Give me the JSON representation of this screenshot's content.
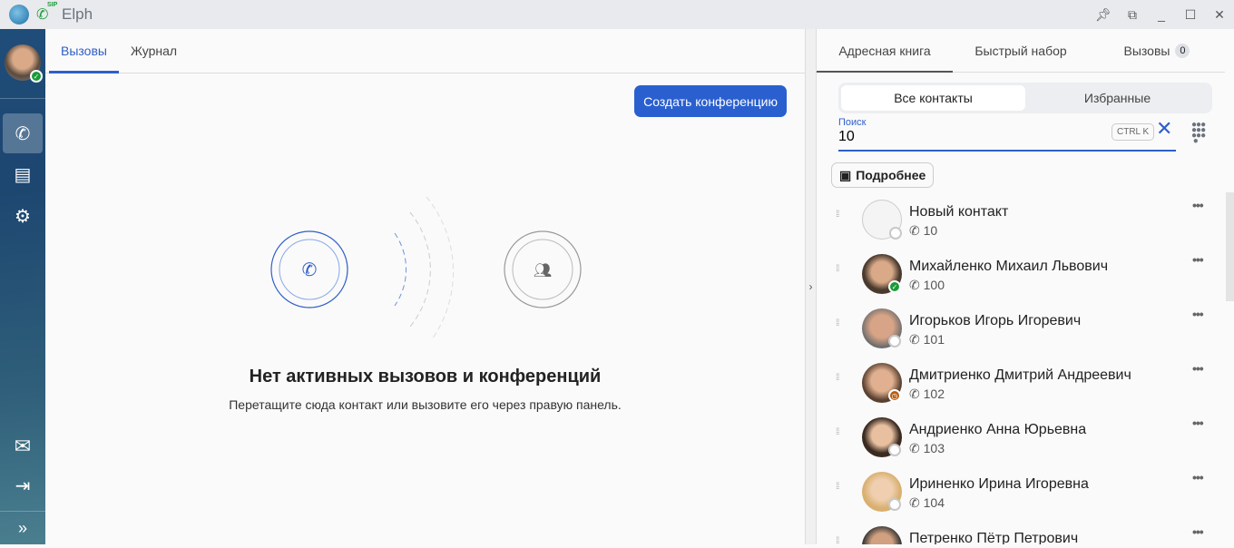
{
  "window": {
    "title": "Elph",
    "sip_label": "SIP"
  },
  "main": {
    "tabs": [
      {
        "label": "Вызовы"
      },
      {
        "label": "Журнал"
      }
    ],
    "create_conference": "Создать конференцию",
    "empty_title": "Нет активных вызовов и конференций",
    "empty_subtitle": "Перетащите сюда контакт или вызовите его через правую панель."
  },
  "right": {
    "tabs": [
      {
        "label": "Адресная книга"
      },
      {
        "label": "Быстрый набор"
      },
      {
        "label": "Вызовы",
        "count": "0"
      }
    ],
    "segments": [
      "Все контакты",
      "Избранные"
    ],
    "search": {
      "label": "Поиск",
      "value": "10",
      "shortcut": "CTRL K"
    },
    "details_button": "Подробнее",
    "contacts": [
      {
        "name": "Новый контакт",
        "number": "10",
        "status": "none"
      },
      {
        "name": "Михайленко Михаил Львович",
        "number": "100",
        "status": "online"
      },
      {
        "name": "Игорьков Игорь Игоревич",
        "number": "101",
        "status": "offline"
      },
      {
        "name": "Дмитриенко Дмитрий Андреевич",
        "number": "102",
        "status": "away"
      },
      {
        "name": "Андриенко Анна Юрьевна",
        "number": "103",
        "status": "offline"
      },
      {
        "name": "Ириненко Ирина Игоревна",
        "number": "104",
        "status": "offline"
      },
      {
        "name": "Петренко Пётр Петрович",
        "number": "",
        "status": "offline"
      }
    ]
  },
  "colors": {
    "accent": "#2a5fcf",
    "online": "#1a9a3a",
    "away": "#b85c10"
  }
}
